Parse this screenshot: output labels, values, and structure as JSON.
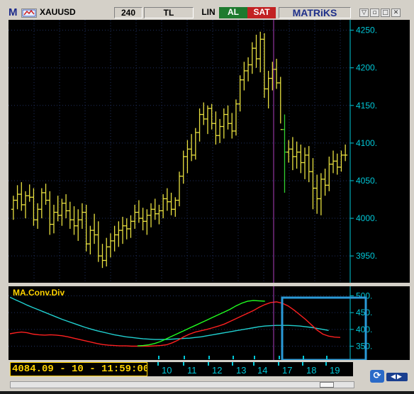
{
  "toolbar": {
    "logo": "M",
    "symbol": "XAUUSD",
    "period": "240",
    "currency": "TL",
    "scale": "LIN",
    "buy_label": "AL",
    "sell_label": "SAT",
    "brand": "MATRiKS",
    "window_buttons": [
      "▽",
      "▫",
      "□",
      "✕"
    ]
  },
  "readout": "4084.09 - 10 - 11:59:00",
  "colors": {
    "background": "#000000",
    "axis": "#00c8d8",
    "price_bars": "#e8e040",
    "macd": "#ff2020",
    "signal": "#20ff20",
    "ma_line": "#20d0d0",
    "cursor_line": "#b040c0",
    "highlight_box": "#2a9ad8",
    "indicator_label": "#ffd200"
  },
  "chart_data": [
    {
      "type": "ohlc",
      "title": "",
      "xlabel": "",
      "ylabel": "",
      "y_ticks": [
        "4250.",
        "4200.",
        "4150.",
        "4100.",
        "4050.",
        "4000.",
        "3950."
      ],
      "ylim": [
        3920,
        4260
      ],
      "x_ticks": [
        "10",
        "11",
        "12",
        "13",
        "14",
        "17",
        "18",
        "19"
      ],
      "grid": true,
      "bars": [
        [
          4012,
          4030,
          3998,
          4024
        ],
        [
          4024,
          4044,
          4012,
          4032
        ],
        [
          4032,
          4048,
          4010,
          4018
        ],
        [
          4018,
          4036,
          4000,
          4030
        ],
        [
          4030,
          4045,
          4022,
          4028
        ],
        [
          4028,
          4040,
          3990,
          3998
        ],
        [
          3998,
          4020,
          3986,
          4012
        ],
        [
          4012,
          4040,
          4000,
          4034
        ],
        [
          4034,
          4046,
          4018,
          4024
        ],
        [
          4024,
          4036,
          3978,
          3992
        ],
        [
          3992,
          4018,
          3980,
          4008
        ],
        [
          4008,
          4030,
          3996,
          4004
        ],
        [
          4004,
          4026,
          3990,
          4020
        ],
        [
          4020,
          4032,
          4000,
          4010
        ],
        [
          4010,
          4022,
          3986,
          3998
        ],
        [
          3998,
          4016,
          3978,
          3990
        ],
        [
          3990,
          4012,
          3970,
          3998
        ],
        [
          3998,
          4020,
          3986,
          4008
        ],
        [
          4008,
          4018,
          3956,
          3966
        ],
        [
          3966,
          3990,
          3952,
          3984
        ],
        [
          3984,
          4006,
          3966,
          3978
        ],
        [
          3978,
          3996,
          3942,
          3950
        ],
        [
          3950,
          3966,
          3934,
          3944
        ],
        [
          3944,
          3974,
          3936,
          3962
        ],
        [
          3962,
          3980,
          3948,
          3970
        ],
        [
          3970,
          3990,
          3956,
          3978
        ],
        [
          3978,
          3996,
          3962,
          3984
        ],
        [
          3984,
          4002,
          3966,
          3990
        ],
        [
          3990,
          4000,
          3972,
          3986
        ],
        [
          3986,
          4004,
          3974,
          3996
        ],
        [
          3996,
          4018,
          3986,
          4008
        ],
        [
          4008,
          4024,
          3994,
          4000
        ],
        [
          4000,
          4014,
          3984,
          3996
        ],
        [
          3996,
          4012,
          3978,
          4004
        ],
        [
          4004,
          4020,
          3988,
          4012
        ],
        [
          4012,
          4026,
          3998,
          4006
        ],
        [
          4006,
          4018,
          3992,
          4010
        ],
        [
          4010,
          4032,
          4000,
          4026
        ],
        [
          4026,
          4040,
          4010,
          4022
        ],
        [
          4022,
          4034,
          4004,
          4012
        ],
        [
          4012,
          4028,
          4002,
          4024
        ],
        [
          4024,
          4062,
          4016,
          4056
        ],
        [
          4056,
          4090,
          4046,
          4082
        ],
        [
          4082,
          4104,
          4060,
          4092
        ],
        [
          4092,
          4112,
          4076,
          4084
        ],
        [
          4084,
          4120,
          4078,
          4114
        ],
        [
          4114,
          4146,
          4102,
          4138
        ],
        [
          4138,
          4154,
          4124,
          4132
        ],
        [
          4132,
          4150,
          4112,
          4146
        ],
        [
          4146,
          4152,
          4118,
          4126
        ],
        [
          4126,
          4142,
          4098,
          4110
        ],
        [
          4110,
          4132,
          4100,
          4122
        ],
        [
          4122,
          4146,
          4106,
          4138
        ],
        [
          4138,
          4150,
          4118,
          4126
        ],
        [
          4126,
          4140,
          4106,
          4116
        ],
        [
          4116,
          4158,
          4110,
          4152
        ],
        [
          4152,
          4190,
          4142,
          4184
        ],
        [
          4184,
          4208,
          4170,
          4196
        ],
        [
          4196,
          4214,
          4182,
          4204
        ],
        [
          4204,
          4234,
          4192,
          4226
        ],
        [
          4226,
          4244,
          4200,
          4212
        ],
        [
          4212,
          4248,
          4194,
          4238
        ],
        [
          4238,
          4246,
          4160,
          4172
        ],
        [
          4172,
          4196,
          4146,
          4186
        ],
        [
          4186,
          4208,
          4170,
          4198
        ],
        [
          4198,
          4212,
          4172,
          4180
        ],
        [
          4180,
          4188,
          4126,
          4118
        ],
        [
          4118,
          4138,
          4034,
          4088
        ],
        [
          4088,
          4104,
          4074,
          4092
        ],
        [
          4092,
          4108,
          4064,
          4082
        ],
        [
          4082,
          4102,
          4066,
          4088
        ],
        [
          4088,
          4098,
          4060,
          4074
        ],
        [
          4074,
          4094,
          4052,
          4084
        ],
        [
          4084,
          4096,
          4048,
          4062
        ],
        [
          4062,
          4080,
          4012,
          4040
        ],
        [
          4040,
          4058,
          4006,
          4026
        ],
        [
          4026,
          4060,
          4004,
          4052
        ],
        [
          4052,
          4066,
          4030,
          4044
        ],
        [
          4044,
          4082,
          4036,
          4072
        ],
        [
          4072,
          4090,
          4060,
          4076
        ],
        [
          4076,
          4086,
          4058,
          4068
        ],
        [
          4068,
          4090,
          4062,
          4084
        ],
        [
          4084,
          4098,
          4076,
          4084
        ]
      ]
    },
    {
      "type": "line",
      "title": "MA.Conv.Div",
      "y_ticks": [
        "500.",
        "450.",
        "400.",
        "350."
      ],
      "ylim": [
        330,
        520
      ],
      "grid": true,
      "series": [
        {
          "name": "",
          "color": "#20d0d0",
          "values": [
            496,
            488,
            480,
            472,
            465,
            458,
            451,
            444,
            437,
            430,
            424,
            418,
            412,
            406,
            401,
            396,
            392,
            388,
            384,
            381,
            378,
            376,
            374,
            372,
            371,
            370,
            370,
            370,
            371,
            372,
            373,
            374,
            376,
            378,
            381,
            384,
            387,
            390,
            393,
            396,
            399,
            402,
            405,
            408,
            410,
            411,
            412,
            412,
            412,
            411,
            410,
            408,
            406,
            403,
            400,
            397
          ]
        },
        {
          "name": "",
          "color": "#ff2020",
          "values": [
            387,
            390,
            392,
            390,
            386,
            384,
            383,
            384,
            383,
            381,
            378,
            374,
            370,
            366,
            362,
            358,
            355,
            353,
            352,
            351,
            351,
            350,
            350,
            350,
            350,
            351,
            352,
            354,
            360,
            368,
            378,
            386,
            392,
            396,
            400,
            405,
            410,
            416,
            424,
            432,
            440,
            448,
            456,
            466,
            474,
            480,
            482,
            478,
            470,
            458,
            444,
            430,
            414,
            398,
            386,
            380,
            377,
            376
          ]
        },
        {
          "name": "",
          "color": "#20ff20",
          "values": [
            null,
            null,
            null,
            null,
            null,
            null,
            null,
            null,
            null,
            null,
            null,
            null,
            null,
            null,
            null,
            null,
            null,
            null,
            null,
            null,
            null,
            null,
            351,
            352,
            354,
            358,
            364,
            372,
            380,
            388,
            396,
            404,
            412,
            420,
            428,
            436,
            444,
            452,
            460,
            470,
            478,
            484,
            486,
            485,
            484
          ]
        }
      ]
    }
  ]
}
